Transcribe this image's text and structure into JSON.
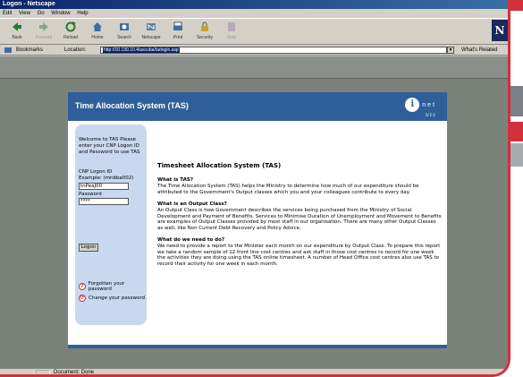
{
  "window": {
    "title": "Logon - Netscape"
  },
  "menu": {
    "items": [
      "Edit",
      "View",
      "Go",
      "Window",
      "Help"
    ]
  },
  "toolbar": {
    "buttons": [
      {
        "label": "Back",
        "icon": "back-arrow-icon"
      },
      {
        "label": "Forward",
        "icon": "forward-arrow-icon"
      },
      {
        "label": "Reload",
        "icon": "reload-icon"
      },
      {
        "label": "Home",
        "icon": "home-icon"
      },
      {
        "label": "Search",
        "icon": "search-icon"
      },
      {
        "label": "Netscape",
        "icon": "netscape-icon"
      },
      {
        "label": "Print",
        "icon": "print-icon"
      },
      {
        "label": "Security",
        "icon": "security-icon"
      },
      {
        "label": "Stop",
        "icon": "stop-icon"
      }
    ]
  },
  "location": {
    "bookmarks_label": "Bookmarks",
    "location_label": "Location:",
    "url": "http://10.130.10.4/ascuba/tadogin.asp",
    "related_label": "What's Related"
  },
  "page": {
    "title": "Time Allocation System (TAS)",
    "logo_letter": "i",
    "logo_text": "net",
    "logo_sub": "WEB"
  },
  "login": {
    "welcome": "Welcome to TAS Please enter your CNP Logon ID and Password to use TAS",
    "id_label": "CNP Logon ID",
    "id_example": "Example: (mnbba002)",
    "id_value": "tnPeaJ00",
    "password_label": "Password",
    "password_value": "****",
    "logon_button": "Logon",
    "forgotten_password": "Forgotten your password",
    "change_password": "Change your password"
  },
  "info": {
    "heading": "Timesheet Allocation System (TAS)",
    "sections": [
      {
        "title": "What is TAS?",
        "body": "The Time Allocation System (TAS) helps the Ministry to determine how much of our expenditure should be attributed to the Government's Output classes which you and your colleagues contribute to every day."
      },
      {
        "title": "What is an Output Class?",
        "body": "An Output Class is how Government describes the services being purchased from the Ministry of Social Development and Payment of Benefits. Services to Minimise Duration of Unemployment and Movement to Benefits are examples of Output Classes provided by most staff in our organisation. There are many other Output Classes as well, like Non Current Debt Recovery and Policy Advice."
      },
      {
        "title": "What do we need to do?",
        "body": "We need to provide a report to the Minister each month on our expenditure by Output Class. To prepare this report we take a random sample of 12 front line cost centres and ask staff in those cost centres to record for one week the activities they are doing using the TAS online timesheet. A number of Head Office cost centres also use TAS to record their activity for one week in each month."
      }
    ]
  },
  "status": {
    "message": "Document: Done"
  },
  "colors": {
    "accent_red": "#d0313b",
    "header_blue": "#2f5f9a",
    "panel_blue": "#c7d8ef",
    "background_grey": "#7b827a"
  }
}
